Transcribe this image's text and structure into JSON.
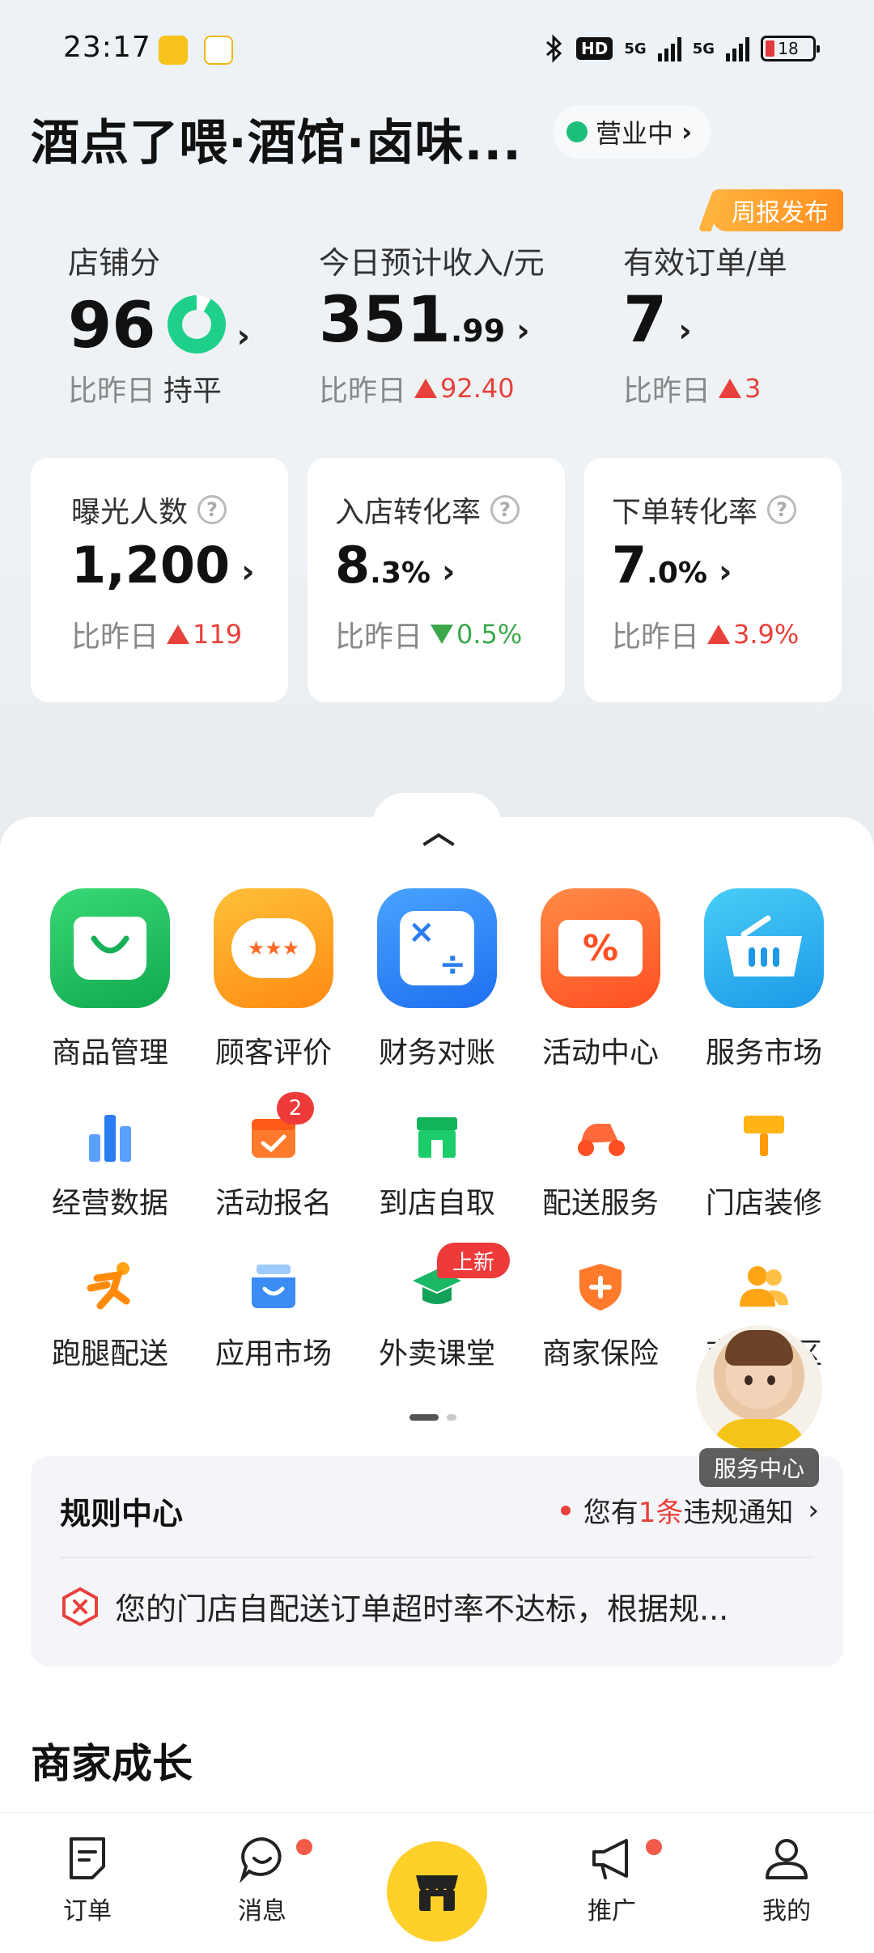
{
  "status_bar": {
    "time": "23:17",
    "network_label": "HD",
    "signal_1": "5G",
    "signal_2": "5G",
    "battery": "18"
  },
  "store": {
    "name": "酒点了喂·酒馆·卤味...",
    "status": "营业中",
    "status_color": "#1cc07a"
  },
  "weekly_badge": "周报发布",
  "metrics": [
    {
      "label": "店铺分",
      "value": "96",
      "compare_label": "比昨日",
      "compare_value": "持平",
      "score_fraction": 0.92
    },
    {
      "label": "今日预计收入/元",
      "value_int": "351",
      "value_dec": ".99",
      "compare_label": "比昨日",
      "compare_value": "92.40",
      "trend": "up"
    },
    {
      "label": "有效订单/单",
      "value": "7",
      "compare_label": "比昨日",
      "compare_value": "3",
      "trend": "up"
    }
  ],
  "cards": [
    {
      "label": "曝光人数",
      "value_int": "1,200",
      "value_dec": "",
      "compare_label": "比昨日",
      "compare_value": "119",
      "trend": "up"
    },
    {
      "label": "入店转化率",
      "value_int": "8",
      "value_dec": ".3%",
      "compare_label": "比昨日",
      "compare_value": "0.5%",
      "trend": "down"
    },
    {
      "label": "下单转化率",
      "value_int": "7",
      "value_dec": ".0%",
      "compare_label": "比昨日",
      "compare_value": "3.9%",
      "trend": "up"
    }
  ],
  "primary_tools": [
    {
      "label": "商品管理",
      "icon": "shopping-bag-icon"
    },
    {
      "label": "顾客评价",
      "icon": "rating-bubble-icon"
    },
    {
      "label": "财务对账",
      "icon": "calculator-icon"
    },
    {
      "label": "活动中心",
      "icon": "coupon-percent-icon"
    },
    {
      "label": "服务市场",
      "icon": "basket-icon"
    }
  ],
  "tools_row2": [
    {
      "label": "经营数据",
      "icon": "bar-chart-icon"
    },
    {
      "label": "活动报名",
      "icon": "calendar-check-icon",
      "badge": "2"
    },
    {
      "label": "到店自取",
      "icon": "storefront-icon"
    },
    {
      "label": "配送服务",
      "icon": "scooter-icon"
    },
    {
      "label": "门店装修",
      "icon": "paint-roller-icon"
    }
  ],
  "tools_row3": [
    {
      "label": "跑腿配送",
      "icon": "runner-icon"
    },
    {
      "label": "应用市场",
      "icon": "app-store-icon"
    },
    {
      "label": "外卖课堂",
      "icon": "graduation-cap-icon",
      "badge": "上新"
    },
    {
      "label": "商家保险",
      "icon": "shield-plus-icon"
    },
    {
      "label": "商家社区",
      "icon": "community-icon"
    }
  ],
  "floating_service": {
    "label": "服务中心"
  },
  "rules": {
    "title": "规则中心",
    "notice_prefix": "您有",
    "notice_count": "1条",
    "notice_suffix": "违规通知",
    "message": "您的门店自配送订单超时率不达标，根据规..."
  },
  "section_title": "商家成长",
  "tabbar": [
    {
      "label": "订单",
      "icon": "order-icon"
    },
    {
      "label": "消息",
      "icon": "message-icon",
      "dot": true
    },
    {
      "label": "",
      "icon": "store-icon"
    },
    {
      "label": "推广",
      "icon": "megaphone-icon",
      "dot": true
    },
    {
      "label": "我的",
      "icon": "profile-icon"
    }
  ],
  "colors": {
    "up": "#e8413b",
    "down": "#3aa84a",
    "accent_yellow": "#ffd02a"
  }
}
